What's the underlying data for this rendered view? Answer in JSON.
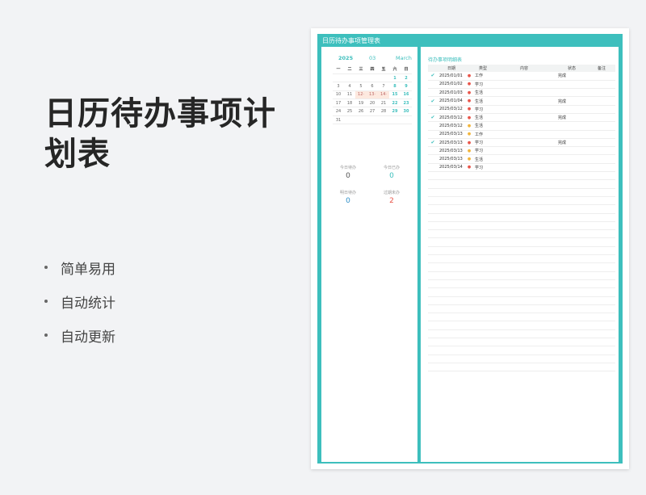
{
  "promo": {
    "title": "日历待办事项计划表",
    "features": [
      "简单易用",
      "自动统计",
      "自动更新"
    ]
  },
  "sheet": {
    "title": "日历待办事项管理表",
    "accent": "#3dbfbd"
  },
  "calendar": {
    "year": "2025",
    "month": "03",
    "month_en": "March",
    "weekdays": [
      "一",
      "二",
      "三",
      "四",
      "五",
      "六",
      "日"
    ],
    "rows": [
      [
        "",
        "",
        "",
        "",
        "",
        "1",
        "2"
      ],
      [
        "3",
        "4",
        "5",
        "6",
        "7",
        "8",
        "9"
      ],
      [
        "10",
        "11",
        "12·",
        "13·",
        "14·",
        "15",
        "16"
      ],
      [
        "17",
        "18",
        "19",
        "20",
        "21",
        "22",
        "23"
      ],
      [
        "24",
        "25",
        "26",
        "27",
        "28",
        "29",
        "30"
      ],
      [
        "31",
        "",
        "",
        "",
        "",
        "",
        ""
      ]
    ],
    "marked_days": [
      "12·",
      "13·",
      "14·"
    ]
  },
  "stats": {
    "today_todo_label": "今日待办",
    "today_todo_value": "0",
    "today_done_label": "今日已办",
    "today_done_value": "0",
    "tomorrow_todo_label": "明日待办",
    "tomorrow_todo_value": "0",
    "overdue_label": "过期未办",
    "overdue_value": "2"
  },
  "todo_table": {
    "title": "待办事项明细表",
    "headers": [
      "",
      "日期",
      "",
      "类型",
      "内容",
      "状态",
      "备注"
    ],
    "rows": [
      {
        "done": true,
        "date": "2025/01/01",
        "dot": "red",
        "type": "工作",
        "content": "",
        "status": "完成",
        "note": ""
      },
      {
        "done": false,
        "date": "2025/01/02",
        "dot": "red",
        "type": "学习",
        "content": "",
        "status": "",
        "note": ""
      },
      {
        "done": false,
        "date": "2025/01/03",
        "dot": "red",
        "type": "生活",
        "content": "",
        "status": "",
        "note": ""
      },
      {
        "done": true,
        "date": "2025/01/04",
        "dot": "red",
        "type": "生活",
        "content": "",
        "status": "完成",
        "note": ""
      },
      {
        "done": false,
        "date": "2025/03/12",
        "dot": "red",
        "type": "学习",
        "content": "",
        "status": "",
        "note": ""
      },
      {
        "done": true,
        "date": "2025/03/12",
        "dot": "red",
        "type": "生活",
        "content": "",
        "status": "完成",
        "note": ""
      },
      {
        "done": false,
        "date": "2025/03/12",
        "dot": "yellow",
        "type": "生活",
        "content": "",
        "status": "",
        "note": ""
      },
      {
        "done": false,
        "date": "2025/03/13",
        "dot": "yellow",
        "type": "工作",
        "content": "",
        "status": "",
        "note": ""
      },
      {
        "done": true,
        "date": "2025/03/13",
        "dot": "red",
        "type": "学习",
        "content": "",
        "status": "完成",
        "note": ""
      },
      {
        "done": false,
        "date": "2025/03/13",
        "dot": "yellow",
        "type": "学习",
        "content": "",
        "status": "",
        "note": ""
      },
      {
        "done": false,
        "date": "2025/03/13",
        "dot": "yellow",
        "type": "生活",
        "content": "",
        "status": "",
        "note": ""
      },
      {
        "done": false,
        "date": "2025/03/14",
        "dot": "red",
        "type": "学习",
        "content": "",
        "status": "",
        "note": ""
      }
    ],
    "check_glyph": "✔",
    "dot_glyph": "●",
    "colors": {
      "red": "#e8554a",
      "yellow": "#f1b53c",
      "blue_value": "#2f8fc8",
      "overdue_value": "#e8554a"
    }
  }
}
